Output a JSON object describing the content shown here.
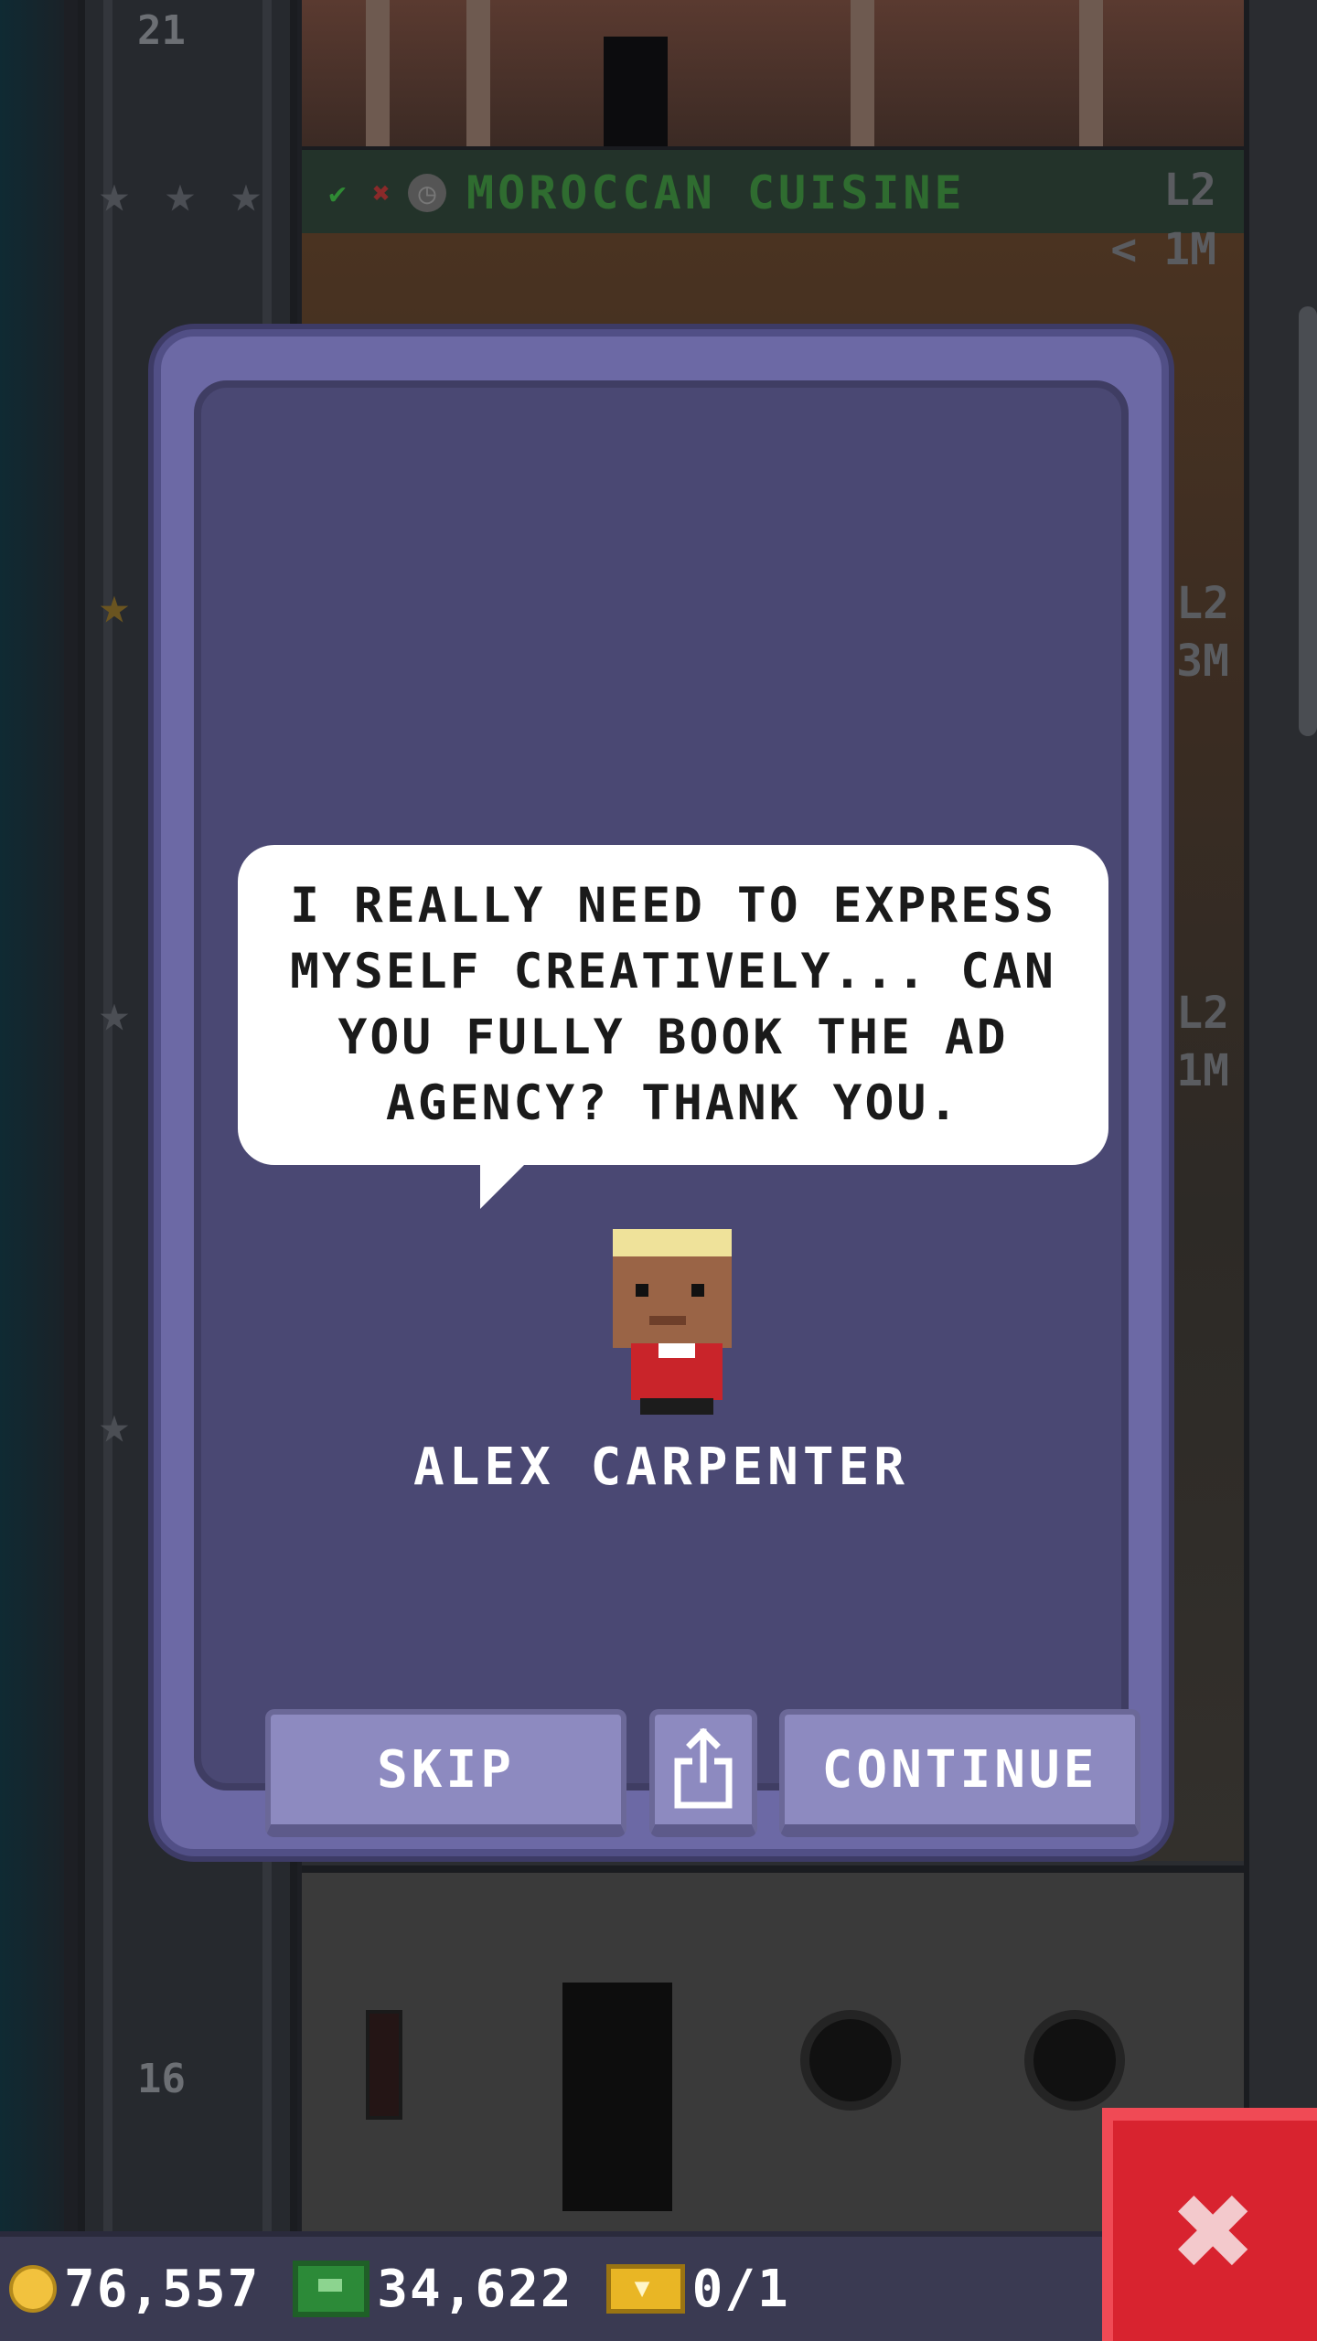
{
  "background": {
    "floor_numbers": [
      "21",
      "16"
    ],
    "floor_name": "MOROCCAN CUISINE",
    "floor_level": "L2",
    "floor_income": "< 1M",
    "side_tags": [
      "L2",
      "3M",
      "L2",
      "1M"
    ]
  },
  "dialog": {
    "message": "I REALLY NEED TO EXPRESS\nMYSELF CREATIVELY... CAN\nYOU FULLY BOOK THE AD\nAGENCY? THANK YOU.",
    "character_name": "ALEX CARPENTER",
    "skip_label": "SKIP",
    "share_icon": "share-icon",
    "continue_label": "CONTINUE"
  },
  "hud": {
    "coins": "76,557",
    "bux": "34,622",
    "tickets": "0/1",
    "close_icon": "close-icon"
  },
  "colors": {
    "dialog_frame": "#6c69a5",
    "dialog_inner": "#4a4873",
    "button": "#8d8ac0",
    "close_button": "#d8232f",
    "floor_name_green": "#2f6c30"
  }
}
